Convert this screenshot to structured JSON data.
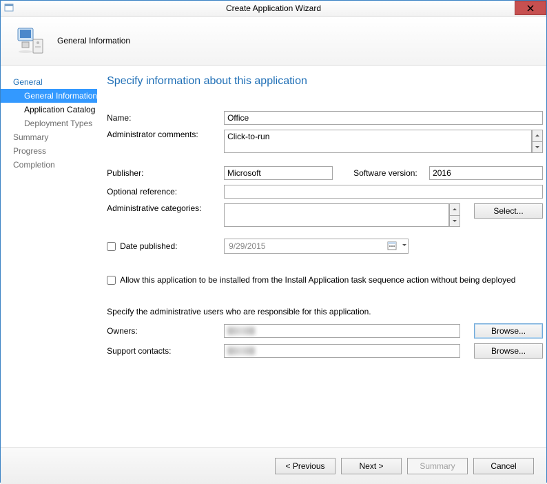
{
  "window": {
    "title": "Create Application Wizard"
  },
  "header": {
    "heading": "General Information"
  },
  "sidebar": {
    "items": [
      {
        "label": "General",
        "kind": "top"
      },
      {
        "label": "General Information",
        "kind": "sub",
        "selected": true
      },
      {
        "label": "Application Catalog",
        "kind": "sub",
        "black": true
      },
      {
        "label": "Deployment Types",
        "kind": "sub",
        "disabled": true
      },
      {
        "label": "Summary",
        "kind": "top",
        "disabled": true
      },
      {
        "label": "Progress",
        "kind": "top",
        "disabled": true
      },
      {
        "label": "Completion",
        "kind": "top",
        "disabled": true
      }
    ]
  },
  "main": {
    "page_title": "Specify information about this application",
    "labels": {
      "name": "Name:",
      "admin_comments": "Administrator comments:",
      "publisher": "Publisher:",
      "software_version": "Software version:",
      "optional_ref": "Optional reference:",
      "admin_categories": "Administrative categories:",
      "select": "Select...",
      "date_published": "Date published:",
      "allow_ts": "Allow this application to be installed from the Install Application task sequence action without being deployed",
      "admin_users_text": "Specify the administrative users who are responsible for this application.",
      "owners": "Owners:",
      "support_contacts": "Support contacts:",
      "browse": "Browse..."
    },
    "values": {
      "name": "Office",
      "admin_comments": "Click-to-run",
      "publisher": "Microsoft",
      "software_version": "2016",
      "optional_ref": "",
      "date_published": "9/29/2015"
    }
  },
  "footer": {
    "previous": "< Previous",
    "next": "Next >",
    "summary": "Summary",
    "cancel": "Cancel"
  }
}
